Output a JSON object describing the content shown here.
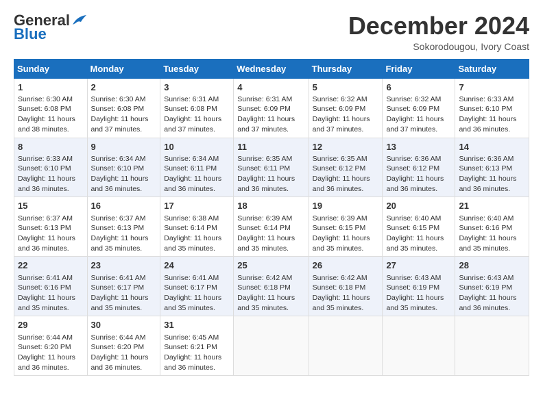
{
  "header": {
    "logo_line1": "General",
    "logo_line2": "Blue",
    "month": "December 2024",
    "location": "Sokorodougou, Ivory Coast"
  },
  "days_of_week": [
    "Sunday",
    "Monday",
    "Tuesday",
    "Wednesday",
    "Thursday",
    "Friday",
    "Saturday"
  ],
  "weeks": [
    [
      {
        "day": "1",
        "info": "Sunrise: 6:30 AM\nSunset: 6:08 PM\nDaylight: 11 hours\nand 38 minutes."
      },
      {
        "day": "2",
        "info": "Sunrise: 6:30 AM\nSunset: 6:08 PM\nDaylight: 11 hours\nand 37 minutes."
      },
      {
        "day": "3",
        "info": "Sunrise: 6:31 AM\nSunset: 6:08 PM\nDaylight: 11 hours\nand 37 minutes."
      },
      {
        "day": "4",
        "info": "Sunrise: 6:31 AM\nSunset: 6:09 PM\nDaylight: 11 hours\nand 37 minutes."
      },
      {
        "day": "5",
        "info": "Sunrise: 6:32 AM\nSunset: 6:09 PM\nDaylight: 11 hours\nand 37 minutes."
      },
      {
        "day": "6",
        "info": "Sunrise: 6:32 AM\nSunset: 6:09 PM\nDaylight: 11 hours\nand 37 minutes."
      },
      {
        "day": "7",
        "info": "Sunrise: 6:33 AM\nSunset: 6:10 PM\nDaylight: 11 hours\nand 36 minutes."
      }
    ],
    [
      {
        "day": "8",
        "info": "Sunrise: 6:33 AM\nSunset: 6:10 PM\nDaylight: 11 hours\nand 36 minutes."
      },
      {
        "day": "9",
        "info": "Sunrise: 6:34 AM\nSunset: 6:10 PM\nDaylight: 11 hours\nand 36 minutes."
      },
      {
        "day": "10",
        "info": "Sunrise: 6:34 AM\nSunset: 6:11 PM\nDaylight: 11 hours\nand 36 minutes."
      },
      {
        "day": "11",
        "info": "Sunrise: 6:35 AM\nSunset: 6:11 PM\nDaylight: 11 hours\nand 36 minutes."
      },
      {
        "day": "12",
        "info": "Sunrise: 6:35 AM\nSunset: 6:12 PM\nDaylight: 11 hours\nand 36 minutes."
      },
      {
        "day": "13",
        "info": "Sunrise: 6:36 AM\nSunset: 6:12 PM\nDaylight: 11 hours\nand 36 minutes."
      },
      {
        "day": "14",
        "info": "Sunrise: 6:36 AM\nSunset: 6:13 PM\nDaylight: 11 hours\nand 36 minutes."
      }
    ],
    [
      {
        "day": "15",
        "info": "Sunrise: 6:37 AM\nSunset: 6:13 PM\nDaylight: 11 hours\nand 36 minutes."
      },
      {
        "day": "16",
        "info": "Sunrise: 6:37 AM\nSunset: 6:13 PM\nDaylight: 11 hours\nand 35 minutes."
      },
      {
        "day": "17",
        "info": "Sunrise: 6:38 AM\nSunset: 6:14 PM\nDaylight: 11 hours\nand 35 minutes."
      },
      {
        "day": "18",
        "info": "Sunrise: 6:39 AM\nSunset: 6:14 PM\nDaylight: 11 hours\nand 35 minutes."
      },
      {
        "day": "19",
        "info": "Sunrise: 6:39 AM\nSunset: 6:15 PM\nDaylight: 11 hours\nand 35 minutes."
      },
      {
        "day": "20",
        "info": "Sunrise: 6:40 AM\nSunset: 6:15 PM\nDaylight: 11 hours\nand 35 minutes."
      },
      {
        "day": "21",
        "info": "Sunrise: 6:40 AM\nSunset: 6:16 PM\nDaylight: 11 hours\nand 35 minutes."
      }
    ],
    [
      {
        "day": "22",
        "info": "Sunrise: 6:41 AM\nSunset: 6:16 PM\nDaylight: 11 hours\nand 35 minutes."
      },
      {
        "day": "23",
        "info": "Sunrise: 6:41 AM\nSunset: 6:17 PM\nDaylight: 11 hours\nand 35 minutes."
      },
      {
        "day": "24",
        "info": "Sunrise: 6:41 AM\nSunset: 6:17 PM\nDaylight: 11 hours\nand 35 minutes."
      },
      {
        "day": "25",
        "info": "Sunrise: 6:42 AM\nSunset: 6:18 PM\nDaylight: 11 hours\nand 35 minutes."
      },
      {
        "day": "26",
        "info": "Sunrise: 6:42 AM\nSunset: 6:18 PM\nDaylight: 11 hours\nand 35 minutes."
      },
      {
        "day": "27",
        "info": "Sunrise: 6:43 AM\nSunset: 6:19 PM\nDaylight: 11 hours\nand 35 minutes."
      },
      {
        "day": "28",
        "info": "Sunrise: 6:43 AM\nSunset: 6:19 PM\nDaylight: 11 hours\nand 36 minutes."
      }
    ],
    [
      {
        "day": "29",
        "info": "Sunrise: 6:44 AM\nSunset: 6:20 PM\nDaylight: 11 hours\nand 36 minutes."
      },
      {
        "day": "30",
        "info": "Sunrise: 6:44 AM\nSunset: 6:20 PM\nDaylight: 11 hours\nand 36 minutes."
      },
      {
        "day": "31",
        "info": "Sunrise: 6:45 AM\nSunset: 6:21 PM\nDaylight: 11 hours\nand 36 minutes."
      },
      {
        "day": "",
        "info": ""
      },
      {
        "day": "",
        "info": ""
      },
      {
        "day": "",
        "info": ""
      },
      {
        "day": "",
        "info": ""
      }
    ]
  ]
}
